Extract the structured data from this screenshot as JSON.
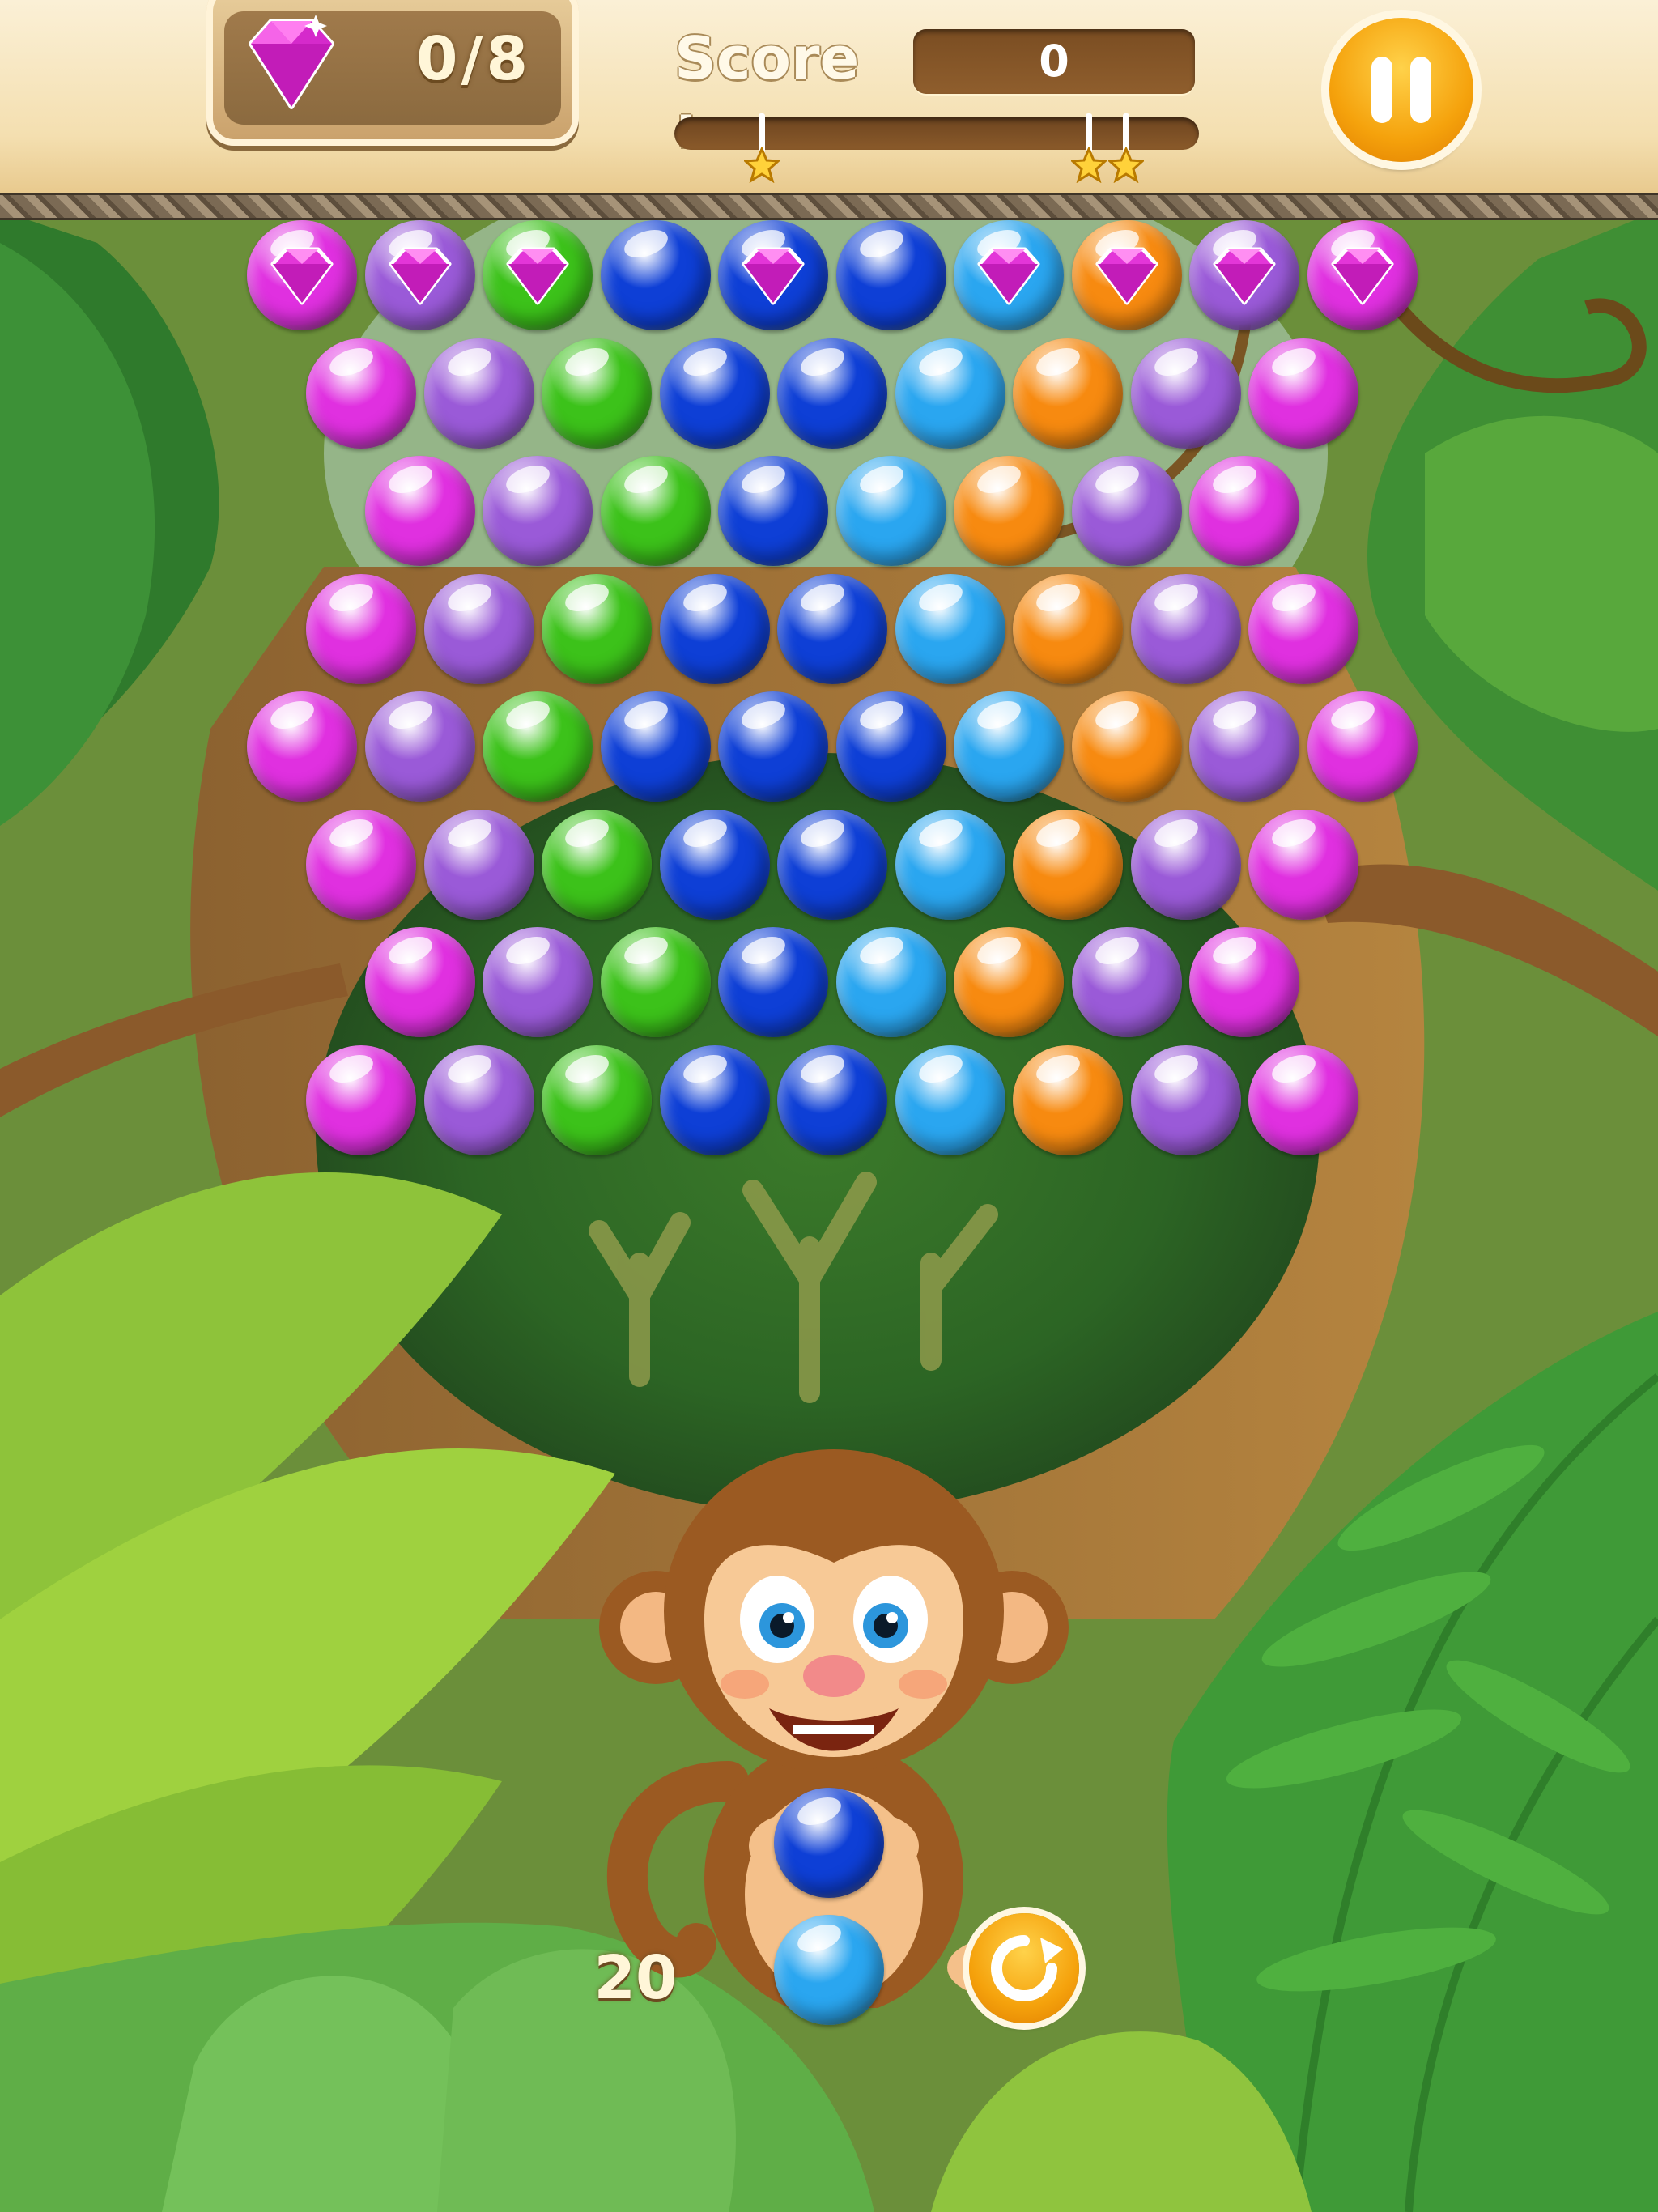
{
  "hud": {
    "gem_counter": "0/8",
    "score_label": "Score :",
    "score_value": "0",
    "star_progress": 0,
    "star_thresholds": [
      1,
      2,
      3
    ],
    "pause_icon": "pause-icon"
  },
  "colors": {
    "magenta": "#e030e0",
    "purple": "#9a5ad8",
    "green": "#3cc21a",
    "blue": "#0e3fd6",
    "lightblue": "#2aa6f0",
    "orange": "#f78a10",
    "accent": "#f5a20c"
  },
  "board": {
    "rows": [
      [
        "magenta*",
        "purple*",
        "green*",
        "blue",
        "blue*",
        "blue",
        "lightblue*",
        "orange*",
        "purple*",
        "magenta*"
      ],
      [
        "magenta",
        "purple",
        "green",
        "blue",
        "blue",
        "lightblue",
        "orange",
        "purple",
        "magenta"
      ],
      [
        "magenta",
        "purple",
        "green",
        "blue",
        "lightblue",
        "orange",
        "purple",
        "magenta"
      ],
      [
        "magenta",
        "purple",
        "green",
        "blue",
        "blue",
        "lightblue",
        "orange",
        "purple",
        "magenta"
      ],
      [
        "magenta",
        "purple",
        "green",
        "blue",
        "blue",
        "blue",
        "lightblue",
        "orange",
        "purple",
        "magenta"
      ],
      [
        "magenta",
        "purple",
        "green",
        "blue",
        "blue",
        "lightblue",
        "orange",
        "purple",
        "magenta"
      ],
      [
        "magenta",
        "purple",
        "green",
        "blue",
        "lightblue",
        "orange",
        "purple",
        "magenta"
      ],
      [
        "magenta",
        "purple",
        "green",
        "blue",
        "blue",
        "lightblue",
        "orange",
        "purple",
        "magenta"
      ]
    ],
    "gem_marker": "*"
  },
  "shooter": {
    "current_bubble": "blue",
    "next_bubble": "lightblue",
    "shots_left": "20",
    "swap_icon": "swap-icon"
  }
}
